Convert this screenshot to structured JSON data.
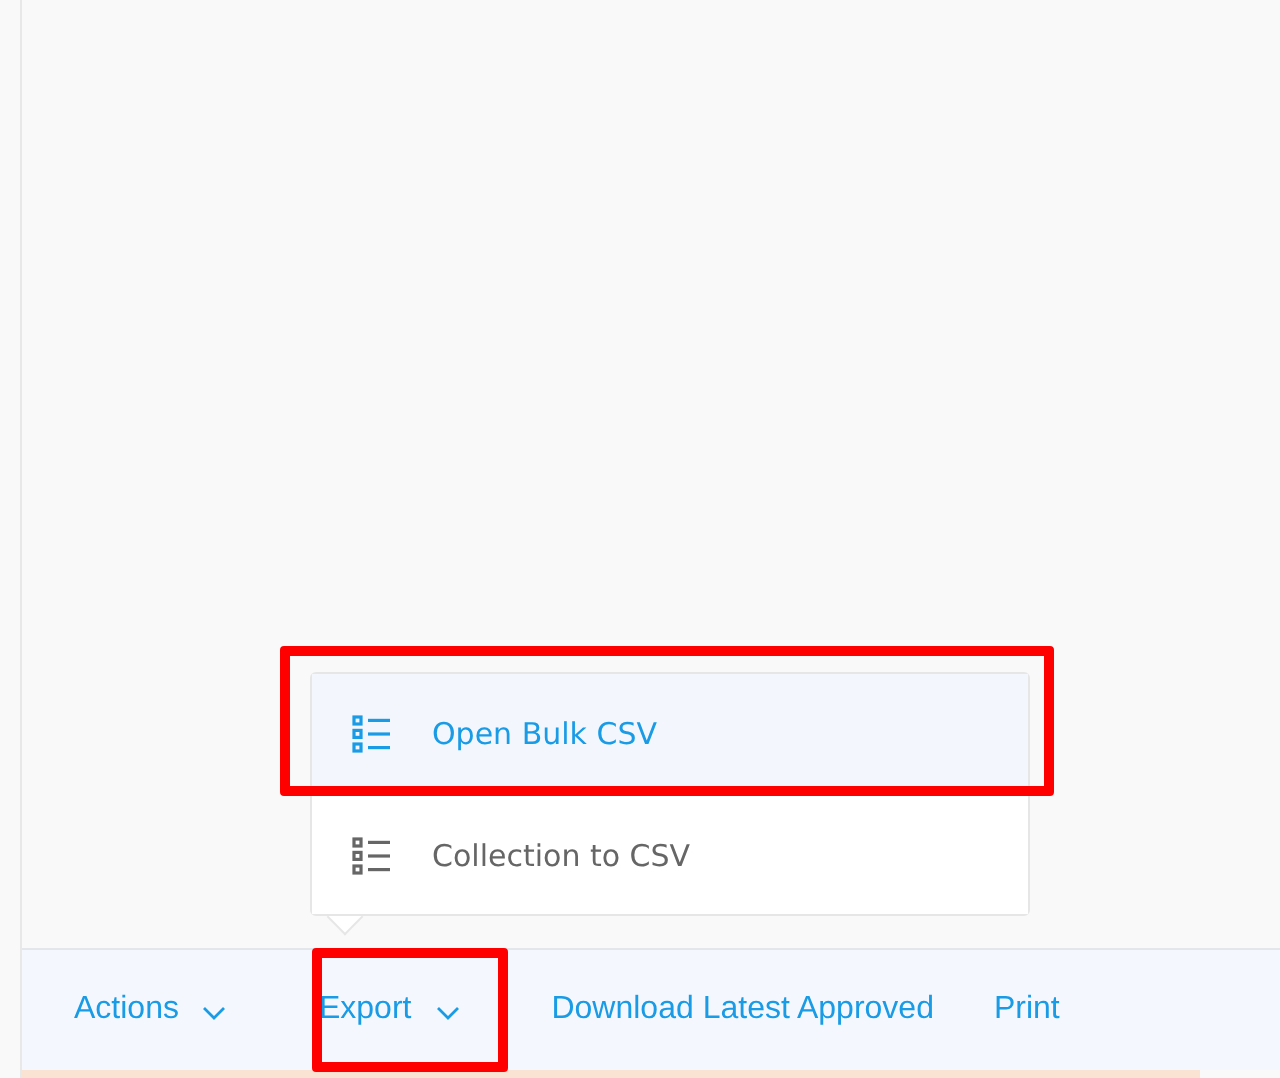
{
  "export_menu": {
    "items": [
      {
        "label": "Open Bulk CSV",
        "selected": true,
        "highlighted": true
      },
      {
        "label": "Collection to CSV",
        "selected": false,
        "highlighted": false
      }
    ]
  },
  "action_bar": {
    "items": [
      {
        "label": "Actions",
        "kind": "dropdown",
        "highlighted": false
      },
      {
        "label": "Export",
        "kind": "dropdown",
        "highlighted": true
      },
      {
        "label": "Download Latest Approved",
        "kind": "link",
        "highlighted": false
      },
      {
        "label": "Print",
        "kind": "link",
        "highlighted": false
      }
    ]
  }
}
